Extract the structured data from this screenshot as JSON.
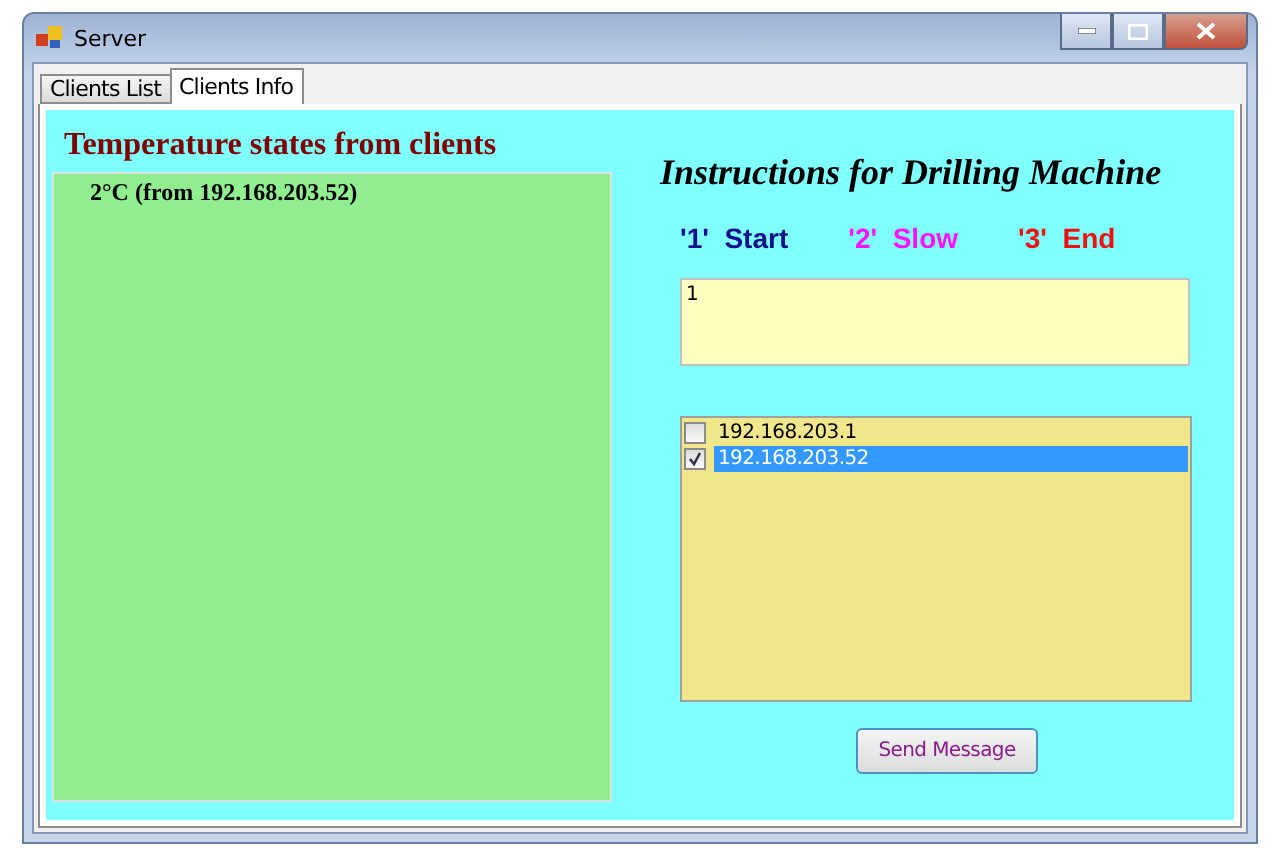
{
  "window": {
    "title": "Server"
  },
  "tabs": [
    {
      "label": "Clients List",
      "selected": false
    },
    {
      "label": "Clients Info",
      "selected": true
    }
  ],
  "temperature": {
    "heading": "Temperature states from clients",
    "entries": [
      "2°C (from 192.168.203.52)"
    ]
  },
  "instructions": {
    "title": "Instructions for Drilling Machine",
    "commands": [
      {
        "code": "'1'",
        "label": "Start",
        "color": "#10108c"
      },
      {
        "code": "'2'",
        "label": "Slow",
        "color": "#ff10ff"
      },
      {
        "code": "'3'",
        "label": "End",
        "color": "#f01010"
      }
    ],
    "message": {
      "value": "1"
    },
    "clients": [
      {
        "label": "192.168.203.1",
        "checked": false,
        "selected": false
      },
      {
        "label": "192.168.203.52",
        "checked": true,
        "selected": true
      }
    ],
    "send_button": "Send Message"
  }
}
